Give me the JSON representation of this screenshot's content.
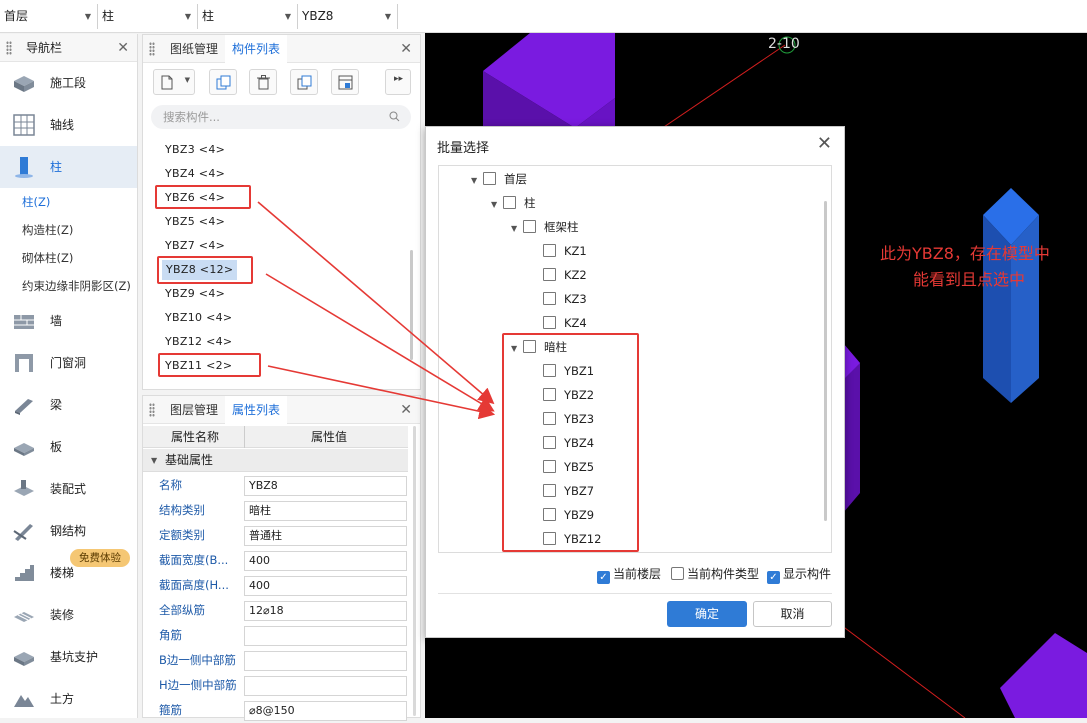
{
  "topbar": {
    "floor": "首层",
    "category": "柱",
    "subcategory": "柱",
    "component": "YBZ8"
  },
  "nav": {
    "title": "导航栏",
    "items": [
      {
        "label": "施工段",
        "icon": "construction-section-icon"
      },
      {
        "label": "轴线",
        "icon": "grid-axis-icon"
      },
      {
        "label": "柱",
        "icon": "column-icon"
      }
    ],
    "sub_items": [
      "柱(Z)",
      "构造柱(Z)",
      "砌体柱(Z)",
      "约束边缘非阴影区(Z)"
    ],
    "items2": [
      {
        "label": "墙",
        "icon": "wall-icon"
      },
      {
        "label": "门窗洞",
        "icon": "door-window-icon"
      },
      {
        "label": "梁",
        "icon": "beam-icon"
      },
      {
        "label": "板",
        "icon": "slab-icon"
      },
      {
        "label": "装配式",
        "icon": "prefab-icon"
      },
      {
        "label": "钢结构",
        "icon": "steel-structure-icon"
      },
      {
        "label": "楼梯",
        "icon": "stair-icon"
      },
      {
        "label": "装修",
        "icon": "decoration-icon"
      },
      {
        "label": "基坑支护",
        "icon": "foundation-pit-icon"
      },
      {
        "label": "土方",
        "icon": "earthwork-icon"
      }
    ],
    "badge": "免费体验"
  },
  "component_panel": {
    "tabs": [
      "图纸管理",
      "构件列表"
    ],
    "search_placeholder": "搜索构件...",
    "rows": [
      "YBZ3 <4>",
      "YBZ4 <4>",
      "YBZ6 <4>",
      "YBZ5 <4>",
      "YBZ7 <4>",
      "YBZ8 <12>",
      "YBZ9 <4>",
      "YBZ10 <4>",
      "YBZ12 <4>",
      "YBZ11 <2>"
    ]
  },
  "property_panel": {
    "tabs": [
      "图层管理",
      "属性列表"
    ],
    "col_name": "属性名称",
    "col_value": "属性值",
    "group": "基础属性",
    "rows": [
      {
        "name": "名称",
        "value": "YBZ8"
      },
      {
        "name": "结构类别",
        "value": "暗柱"
      },
      {
        "name": "定额类别",
        "value": "普通柱"
      },
      {
        "name": "截面宽度(B...",
        "value": "400"
      },
      {
        "name": "截面高度(H...",
        "value": "400"
      },
      {
        "name": "全部纵筋",
        "value": "12⌀18"
      },
      {
        "name": "角筋",
        "value": ""
      },
      {
        "name": "B边一侧中部筋",
        "value": ""
      },
      {
        "name": "H边一侧中部筋",
        "value": ""
      },
      {
        "name": "箍筋",
        "value": "⌀8@150"
      }
    ]
  },
  "canvas": {
    "axis_label": "2-10",
    "annotation_line1": "此为YBZ8，存在模型中",
    "annotation_line2": "能看到且点选中"
  },
  "dialog": {
    "title": "批量选择",
    "tree": {
      "floor": "首层",
      "column": "柱",
      "frame_column": "框架柱",
      "frame_items": [
        "KZ1",
        "KZ2",
        "KZ3",
        "KZ4"
      ],
      "hidden_column": "暗柱",
      "hidden_items": [
        "YBZ1",
        "YBZ2",
        "YBZ3",
        "YBZ4",
        "YBZ5",
        "YBZ7",
        "YBZ9",
        "YBZ12"
      ]
    },
    "opt_current_floor": "当前楼层",
    "opt_current_type": "当前构件类型",
    "opt_show_components": "显示构件",
    "ok": "确定",
    "cancel": "取消"
  },
  "colors": {
    "accent": "#1e6fd9",
    "highlight_red": "#e53935",
    "purple_block": "#7a1be0",
    "blue_block": "#2a6fd8"
  }
}
